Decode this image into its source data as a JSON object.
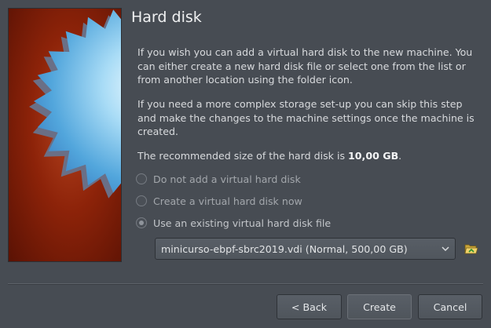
{
  "page": {
    "title": "Hard disk",
    "paragraph1": "If you wish you can add a virtual hard disk to the new machine. You can either create a new hard disk file or select one from the list or from another location using the folder icon.",
    "paragraph2": "If you need a more complex storage set-up you can skip this step and make the changes to the machine settings once the machine is created.",
    "recommended_prefix": "The recommended size of the hard disk is ",
    "recommended_size": "10,00 GB",
    "recommended_suffix": "."
  },
  "options": [
    {
      "label": "Do not add a virtual hard disk",
      "checked": false
    },
    {
      "label": "Create a virtual hard disk now",
      "checked": false
    },
    {
      "label": "Use an existing virtual hard disk file",
      "checked": true
    }
  ],
  "disk_select": {
    "selected": "minicurso-ebpf-sbrc2019.vdi (Normal, 500,00 GB)"
  },
  "icons": {
    "wizard_image": "vbox-disk-burst-icon",
    "dropdown": "chevron-down-icon",
    "folder": "folder-open-icon"
  },
  "buttons": {
    "back": "< Back",
    "create": "Create",
    "cancel": "Cancel"
  }
}
